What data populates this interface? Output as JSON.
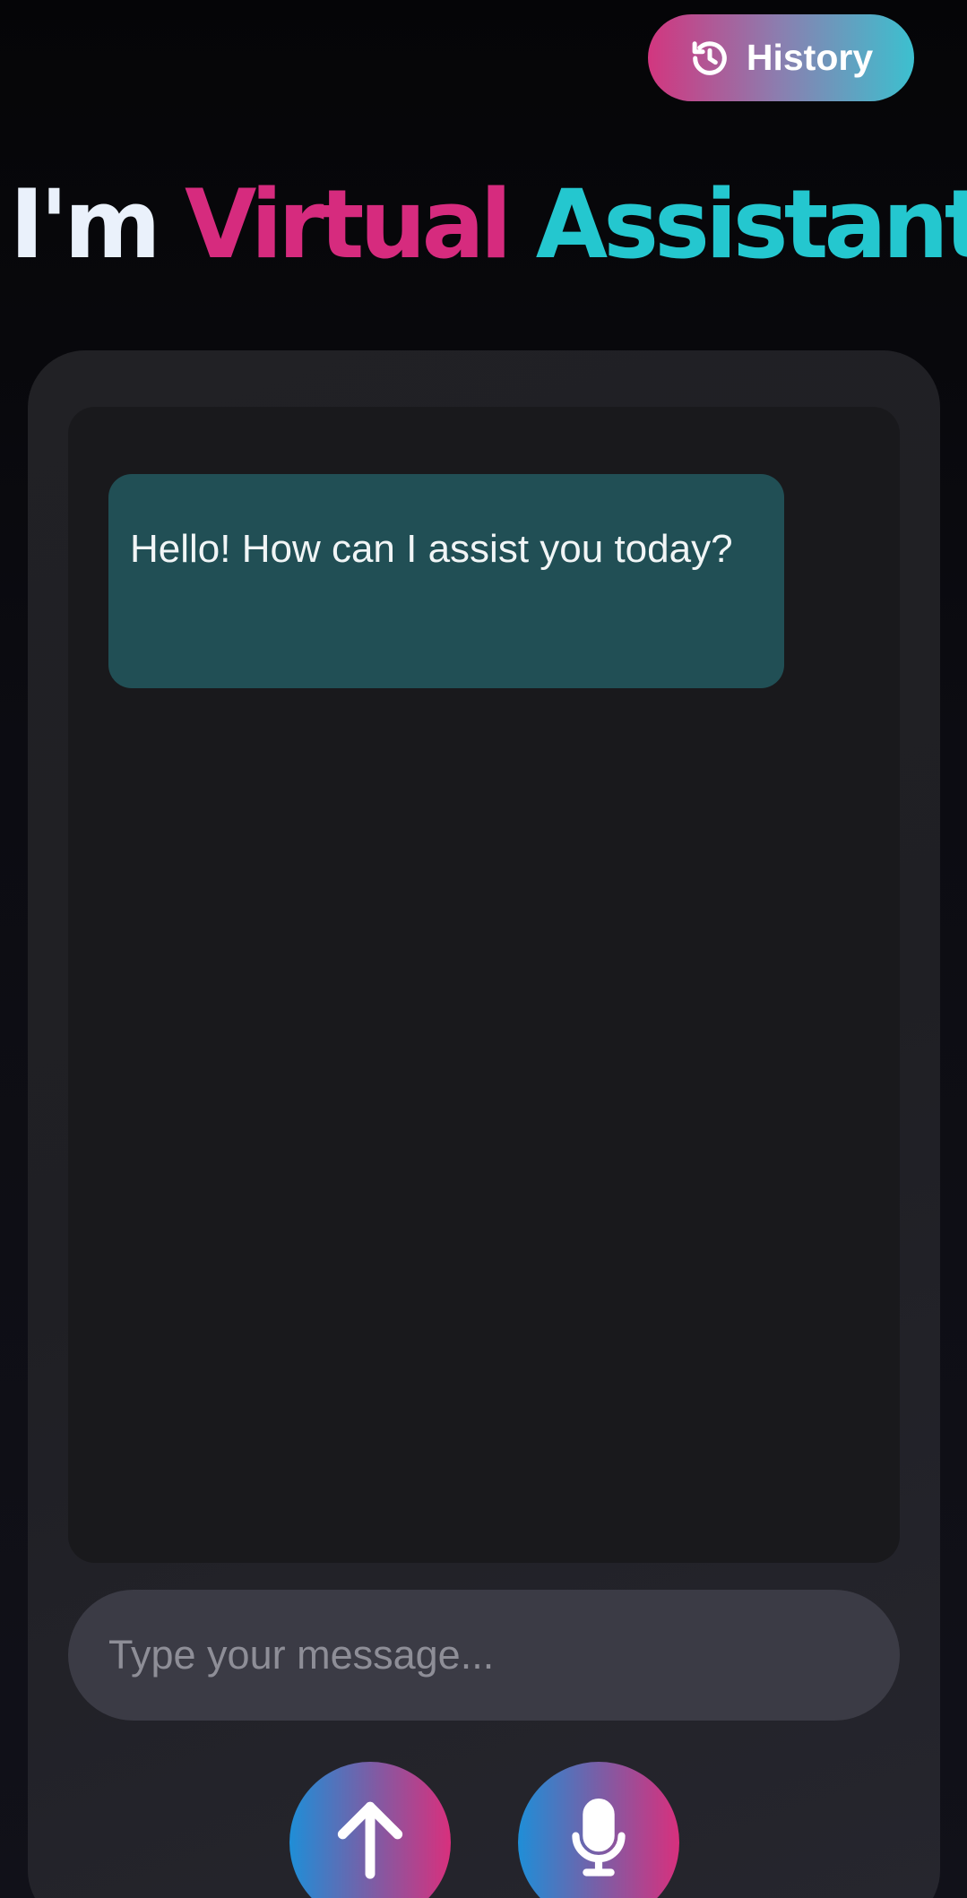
{
  "header": {
    "history_label": "History"
  },
  "title": {
    "part1": "I'm ",
    "part2": "Virtual",
    "part3": " Assistant"
  },
  "chat": {
    "messages": [
      {
        "role": "assistant",
        "text": "Hello! How can I assist you today?"
      }
    ]
  },
  "composer": {
    "placeholder": "Type your message...",
    "value": ""
  },
  "colors": {
    "accent_pink": "#d62b7e",
    "accent_cyan": "#24c7cf",
    "bubble_bg": "#214f55"
  },
  "icons": {
    "history": "history-icon",
    "send": "arrow-up-icon",
    "mic": "microphone-icon"
  }
}
